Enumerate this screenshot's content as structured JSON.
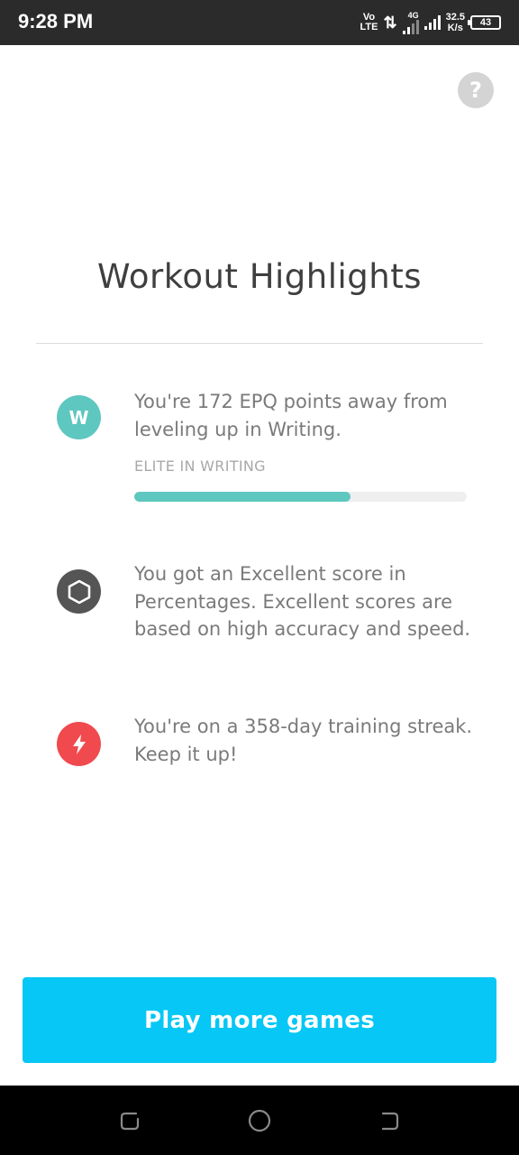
{
  "status_bar": {
    "time": "9:28 PM",
    "volte_top": "Vo",
    "volte_bottom": "LTE",
    "updown": "⇅",
    "network_type": "4G",
    "speed_value": "32.5",
    "speed_unit": "K/s",
    "battery": "43"
  },
  "help": {
    "label": "?"
  },
  "title": "Workout Highlights",
  "highlights": [
    {
      "icon": "letter-w-icon",
      "icon_text": "W",
      "icon_color": "#5ec7bf",
      "text": "You're 172 EPQ points away from leveling up in Writing.",
      "level_label": "ELITE IN WRITING",
      "progress": 0.65
    },
    {
      "icon": "hexagon-icon",
      "icon_color": "#555555",
      "text": "You got an Excellent score in Percentages. Excellent scores are based on high accuracy and speed."
    },
    {
      "icon": "lightning-bolt-icon",
      "icon_color": "#f04a4e",
      "text": "You're on a 358-day training streak. Keep it up!"
    }
  ],
  "primary_button": {
    "label": "Play more games",
    "color": "#06c7f5"
  },
  "nav_bar": {
    "buttons": [
      "recent-apps",
      "home",
      "back"
    ]
  }
}
